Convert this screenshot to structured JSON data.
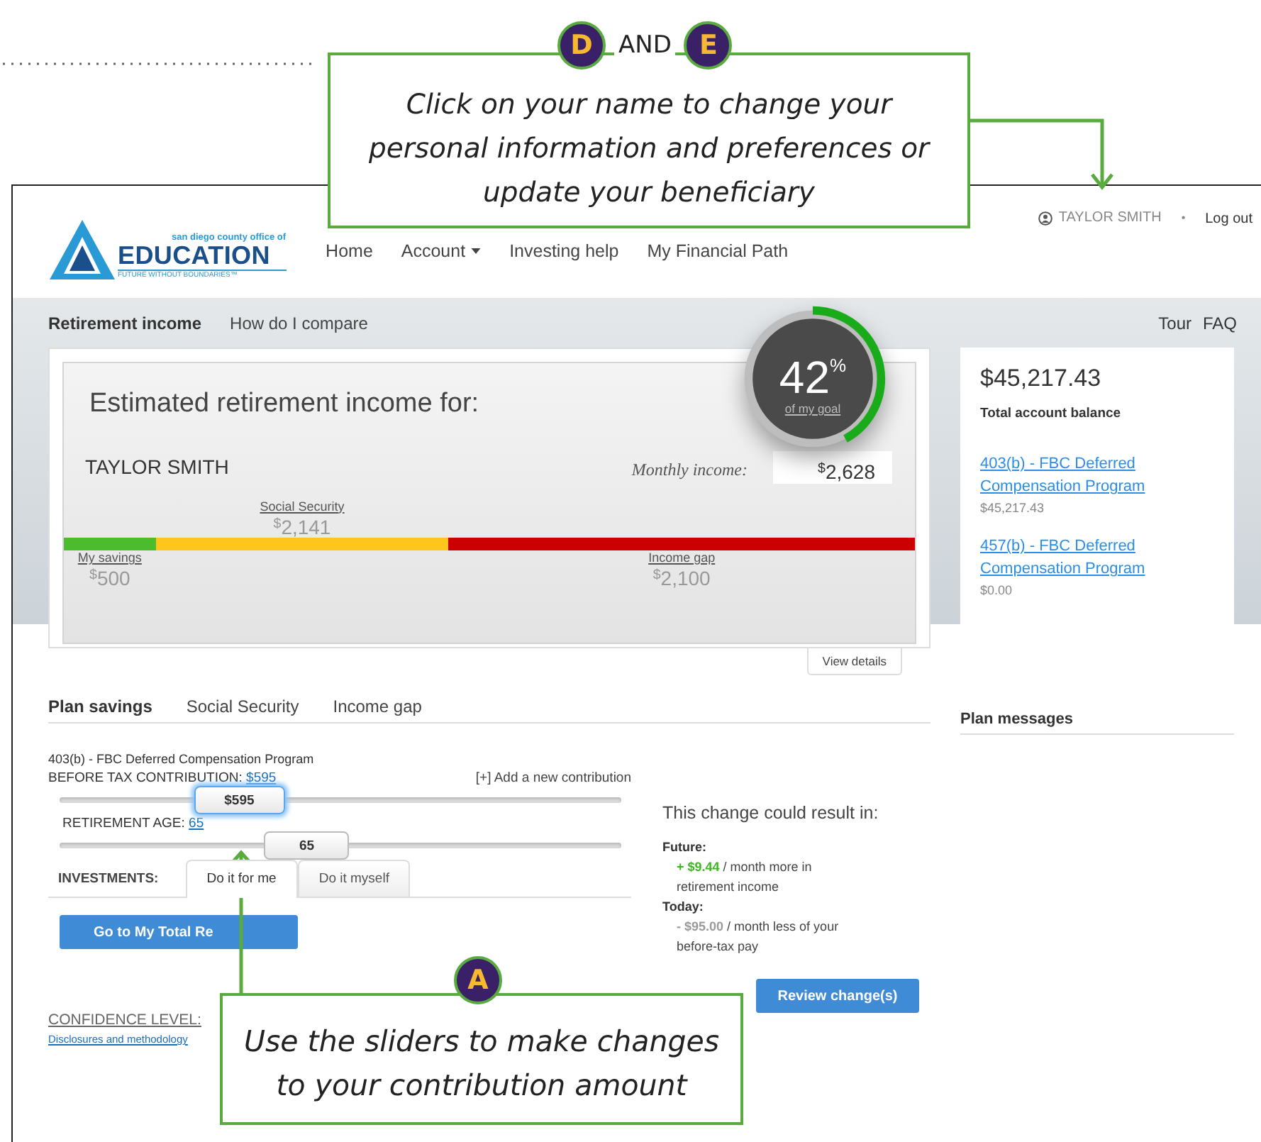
{
  "callouts": [
    {
      "badges": [
        "D",
        "E"
      ],
      "joiner": "AND",
      "text": "Click on your name to change your personal information and preferences or update your beneficiary"
    },
    {
      "badges": [
        "A"
      ],
      "text": "Use the sliders to make changes to your contribution amount"
    }
  ],
  "header": {
    "logo": {
      "top": "san diego county office of",
      "main": "EDUCATION",
      "tagline": "FUTURE WITHOUT BOUNDARIES™"
    },
    "nav": [
      {
        "label": "Home",
        "dropdown": false
      },
      {
        "label": "Account",
        "dropdown": true
      },
      {
        "label": "Investing help",
        "dropdown": false
      },
      {
        "label": "My Financial Path",
        "dropdown": false
      }
    ],
    "user": "TAYLOR SMITH",
    "separator": "•",
    "logout": "Log out"
  },
  "subnav": {
    "tabs": [
      {
        "label": "Retirement income",
        "selected": true
      },
      {
        "label": "How do I compare",
        "selected": false
      }
    ],
    "links": [
      "Tour",
      "FAQ"
    ]
  },
  "income": {
    "title": "Estimated retirement income for:",
    "name": "TAYLOR SMITH",
    "goal": {
      "percent": "42",
      "unit": "%",
      "caption": "of my goal",
      "level": 0.42
    },
    "monthly_label": "Monthly income:",
    "monthly": {
      "currency": "$",
      "amount": "2,628"
    },
    "segments": [
      {
        "label": "My savings",
        "currency": "$",
        "amount": "500",
        "color": "#4cbb2e",
        "level": 0.108,
        "kind": "below"
      },
      {
        "label": "Social Security",
        "currency": "$",
        "amount": "2,141",
        "color": "#fec51d",
        "level": 0.452,
        "kind": "above"
      },
      {
        "label": "Income gap",
        "currency": "$",
        "amount": "2,100",
        "color": "#cc0000",
        "level": 1,
        "kind": "below"
      }
    ],
    "view_details": "View details"
  },
  "balance": {
    "amount": "$45,217.43",
    "label": "Total account balance",
    "accounts": [
      {
        "name": "403(b) - FBC Deferred Compensation Program",
        "balance": "$45,217.43"
      },
      {
        "name": "457(b) - FBC Deferred Compensation Program",
        "balance": "$0.00"
      }
    ]
  },
  "plan": {
    "tabs": [
      {
        "label": "Plan savings",
        "selected": true
      },
      {
        "label": "Social Security",
        "selected": false
      },
      {
        "label": "Income gap",
        "selected": false
      }
    ],
    "program": "403(b) - FBC Deferred Compensation Program",
    "add": "[+] Add a new contribution",
    "sliders": [
      {
        "label": "BEFORE TAX CONTRIBUTION:",
        "value": "$595",
        "thumb": "$595",
        "level": 0.32,
        "focused": true
      },
      {
        "label": "RETIREMENT AGE:",
        "value": "65",
        "thumb": "65",
        "level": 0.44,
        "focused": false
      }
    ],
    "investments": {
      "label": "INVESTMENTS:",
      "tabs": [
        {
          "label": "Do it for me",
          "selected": true
        },
        {
          "label": "Do it myself",
          "selected": false
        }
      ]
    },
    "go_button": "Go to My Total Re",
    "confidence": "CONFIDENCE LEVEL:",
    "disclosures": "Disclosures and methodology",
    "result": {
      "title": "This change could result in:",
      "items": [
        {
          "heading": "Future:",
          "amount": "+ $9.44",
          "kind": "gain",
          "text": "/ month more in retirement income"
        },
        {
          "heading": "Today:",
          "amount": "- $95.00",
          "kind": "loss",
          "text": "/ month less of your before-tax pay"
        }
      ],
      "button": "Review change(s)"
    }
  },
  "messages": {
    "title": "Plan messages"
  }
}
